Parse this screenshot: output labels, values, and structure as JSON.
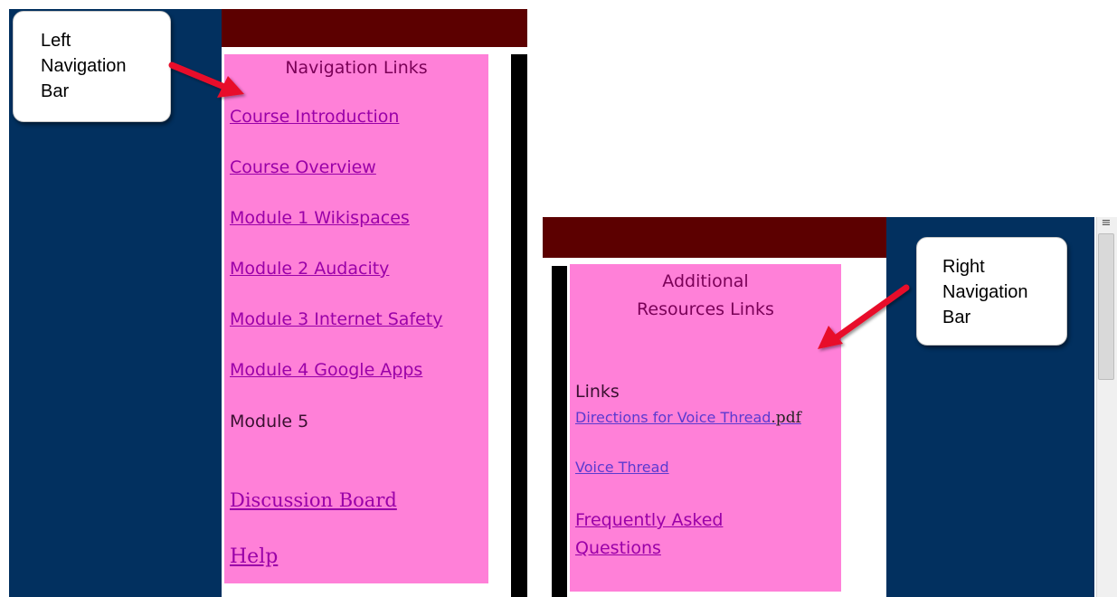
{
  "left_view": {
    "panel_title": "Navigation Links",
    "links": [
      "Course Introduction",
      "Course Overview",
      "Module 1 Wikispaces",
      "Module 2 Audacity",
      "Module 3 Internet Safety",
      "Module 4 Google Apps"
    ],
    "module5_text": "Module 5",
    "discussion_link": "Discussion Board",
    "help_link": "Help"
  },
  "right_view": {
    "panel_title_line1": "Additional",
    "panel_title_line2": "Resources Links",
    "links_heading": "Links",
    "directions_link": "Directions for Voice Thread",
    "directions_suffix": ".pdf",
    "voice_thread_link": "Voice Thread",
    "faq_line1": "Frequently Asked",
    "faq_line2": "Questions"
  },
  "callouts": {
    "left": [
      "Left",
      "Navigation",
      "Bar"
    ],
    "right": [
      "Right",
      "Navigation",
      "Bar"
    ]
  },
  "colors": {
    "navy": "#02305f",
    "header_maroon": "#5c0000",
    "panel_pink": "#ff80d8",
    "arrow_red": "#e8102a"
  }
}
